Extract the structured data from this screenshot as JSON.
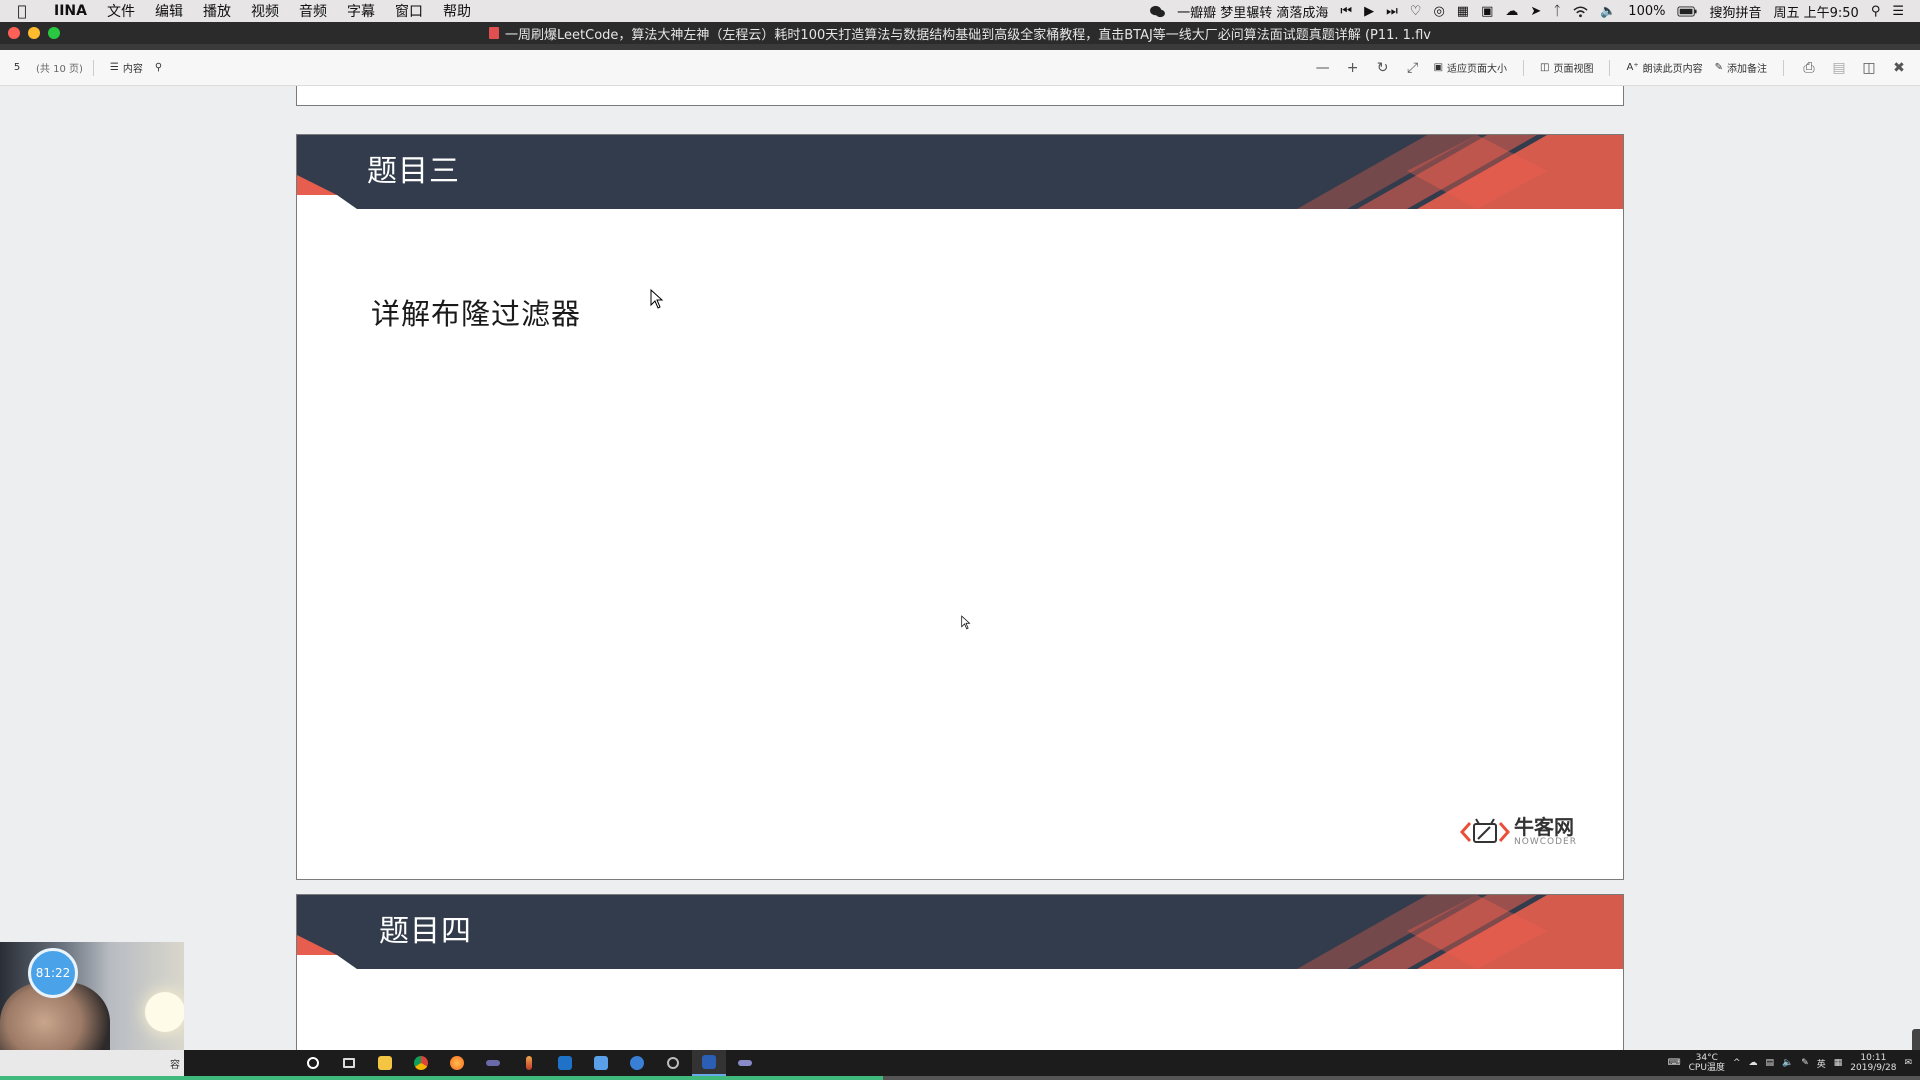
{
  "menubar": {
    "app_name": "IINA",
    "items": [
      "文件",
      "编辑",
      "播放",
      "视频",
      "音频",
      "字幕",
      "窗口",
      "帮助"
    ],
    "now_playing": "一瓣瓣 梦里辗转 滴落成海",
    "battery": "100%",
    "input_method": "搜狗拼音",
    "clock": "周五 上午9:50"
  },
  "window": {
    "title": "一周刷爆LeetCode，算法大神左神（左程云）耗时100天打造算法与数据结构基础到高级全家桶教程，直击BTAJ等一线大厂必问算法面试题真题详解 (P11. 1.flv"
  },
  "toolbar": {
    "page_number": "5",
    "page_count": "(共 10 页)",
    "contents_label": "内容",
    "fit_page_label": "适应页面大小",
    "page_view_label": "页面视图",
    "read_aloud_label": "朗读此页内容",
    "add_note_label": "添加备注"
  },
  "document": {
    "page_main": {
      "banner_title": "题目三",
      "subject": "详解布隆过滤器",
      "logo_cn": "牛客网",
      "logo_en": "NOWCODER"
    },
    "page_next": {
      "banner_title": "题目四"
    },
    "colors": {
      "banner_dark": "#323c4c",
      "banner_accent": "#f2604e"
    }
  },
  "webcam": {
    "timer": "81:22"
  },
  "taskbar": {
    "left_text": "容",
    "weather_temp": "34°C",
    "weather_label": "CPU温度",
    "ime": "英",
    "time": "10:11",
    "date": "2019/9/28",
    "playback_progress": 0.46
  }
}
